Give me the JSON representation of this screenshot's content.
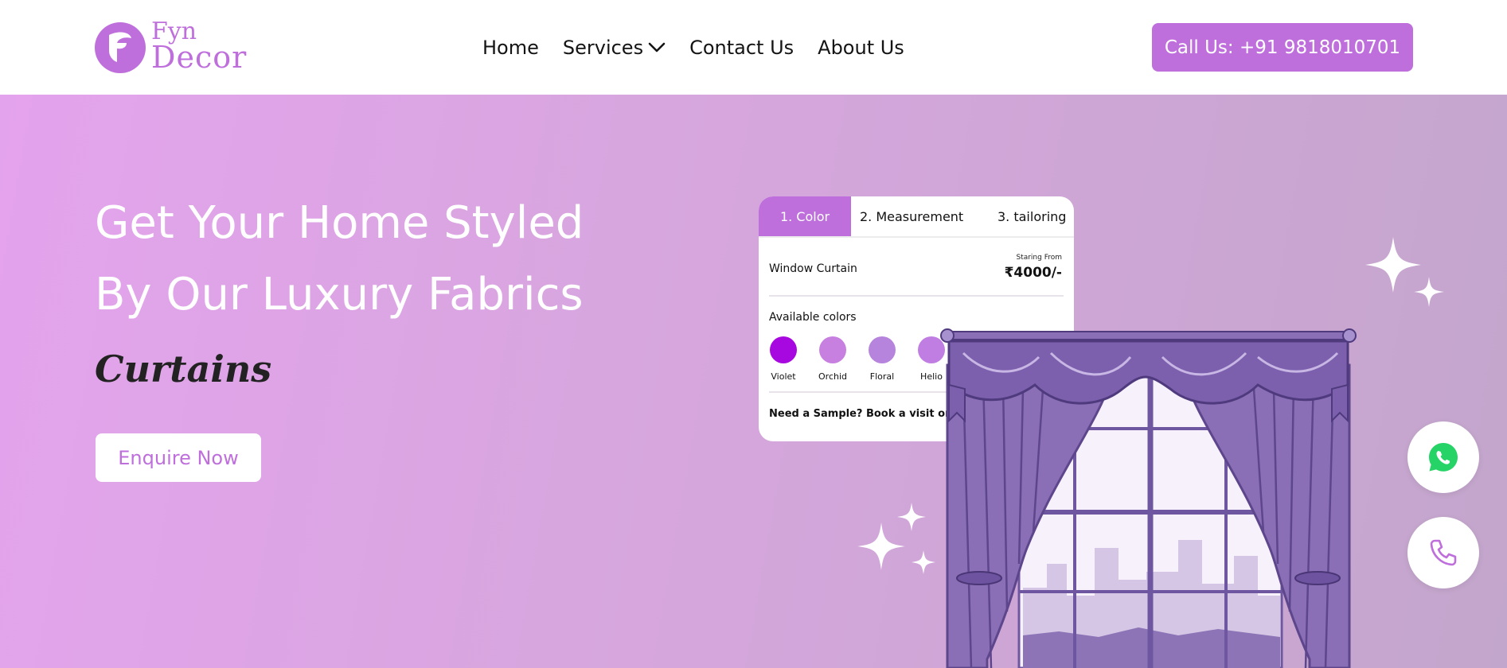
{
  "brand": {
    "line1": "Fyn",
    "line2": "Decor",
    "color": "#bf6fdc"
  },
  "nav": {
    "items": [
      {
        "label": "Home"
      },
      {
        "label": "Services"
      },
      {
        "label": "Contact Us"
      },
      {
        "label": "About Us"
      }
    ]
  },
  "header": {
    "call_label": "Call Us: +91 9818010701"
  },
  "hero": {
    "title_line1": "Get Your Home Styled",
    "title_line2": "By Our Luxury Fabrics",
    "subtitle": "Curtains",
    "cta_label": "Enquire Now"
  },
  "card": {
    "tabs": [
      {
        "label": "1. Color",
        "active": true
      },
      {
        "label": "2. Measurement",
        "active": false
      },
      {
        "label": "3. tailoring",
        "active": false
      }
    ],
    "product": "Window Curtain",
    "price_prefix": "Staring From",
    "price": "₹4000/-",
    "colors_label": "Available colors",
    "colors": [
      {
        "name": "Violet",
        "hex": "#a808e0"
      },
      {
        "name": "Orchid",
        "hex": "#c77fe0"
      },
      {
        "name": "Floral",
        "hex": "#b683dd"
      },
      {
        "name": "Helio",
        "hex": "#c07ee2"
      }
    ],
    "sample_text": "Need a Sample? Book a visit or Call us:"
  },
  "icons": {
    "whatsapp": "whatsapp-icon",
    "phone": "phone-icon",
    "services_dropdown": "chevron-down-icon"
  },
  "colors": {
    "accent": "#bf6fdc",
    "hero_gradient_start": "#e4a3ed",
    "hero_gradient_end": "#c3a6cc",
    "whatsapp_green": "#25d366"
  }
}
